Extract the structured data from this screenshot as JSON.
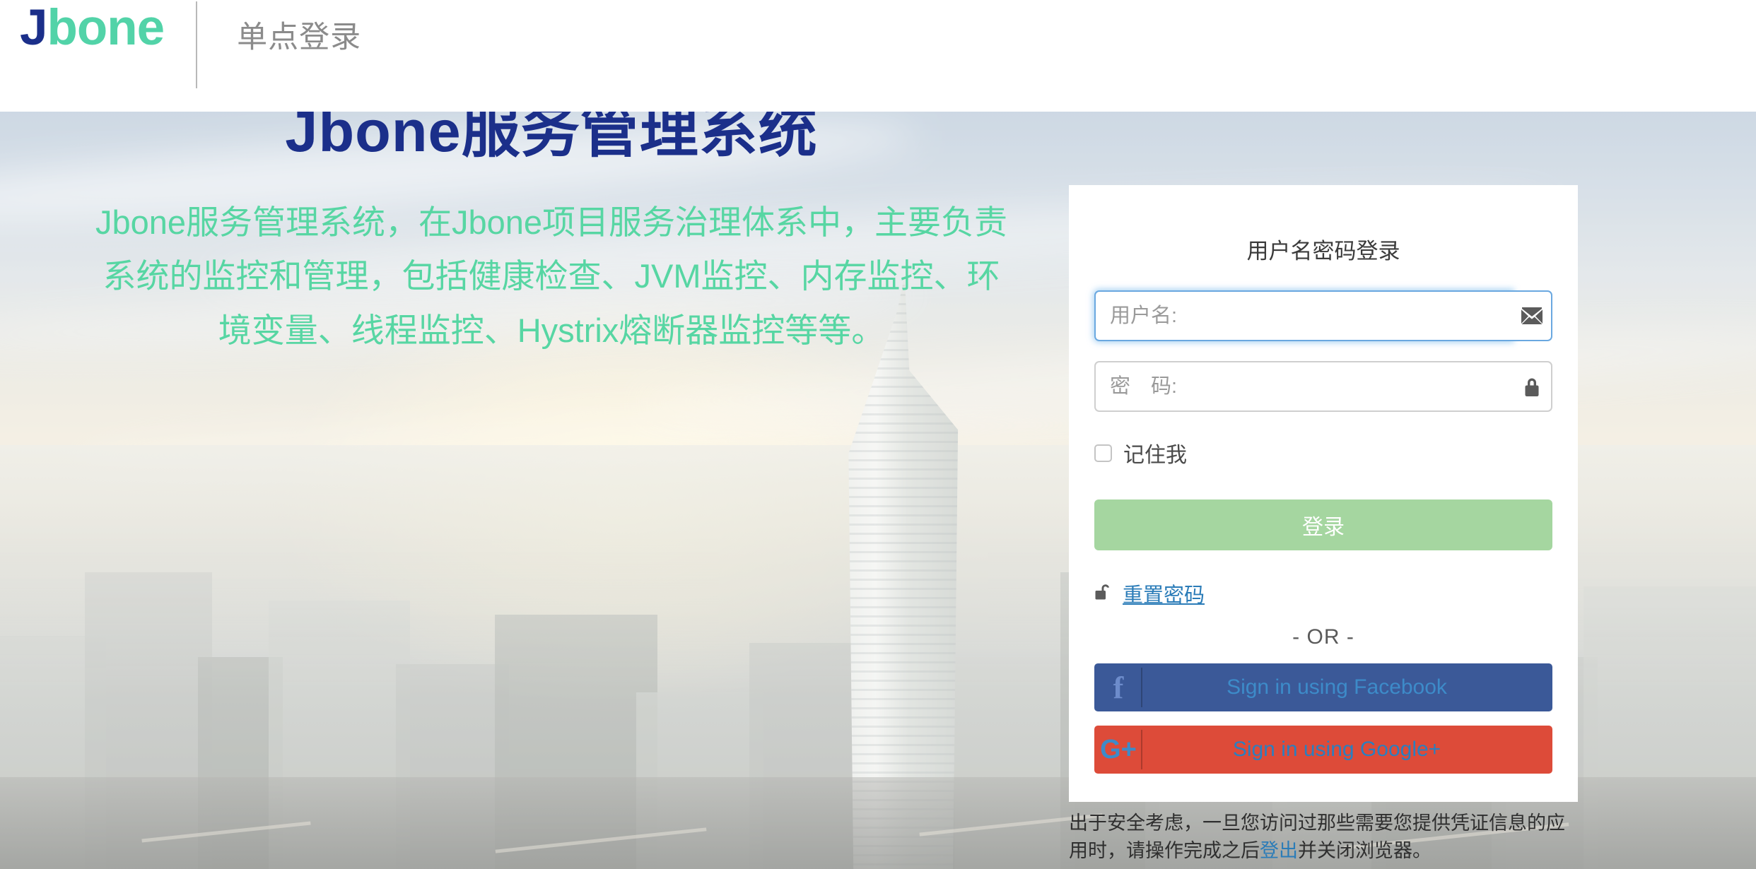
{
  "header": {
    "brand_j": "J",
    "brand_rest": "bone",
    "subtitle": "单点登录"
  },
  "hero": {
    "title": "Jbone服务管理系统",
    "description": "Jbone服务管理系统，在Jbone项目服务治理体系中，主要负责系统的监控和管理，包括健康检查、JVM监控、内存监控、环境变量、线程监控、Hystrix熔断器监控等等。"
  },
  "login": {
    "card_title": "用户名密码登录",
    "username": {
      "value": "",
      "placeholder": "用户名:",
      "icon": "envelope-icon"
    },
    "password": {
      "value": "",
      "placeholder": "密　码:",
      "icon": "lock-icon"
    },
    "remember": {
      "label": "记住我",
      "checked": false
    },
    "submit_label": "登录",
    "reset": {
      "icon": "unlock-icon",
      "label": "重置密码"
    },
    "or_label": "- OR -",
    "social": [
      {
        "provider": "facebook",
        "icon": "facebook-icon",
        "glyph": "f",
        "label": "Sign in using Facebook",
        "bg": "#3b5998"
      },
      {
        "provider": "google-plus",
        "icon": "google-plus-icon",
        "glyph": "G+",
        "label": "Sign in using Google+",
        "bg": "#dd4b39"
      }
    ]
  },
  "security_notice": {
    "part1": "出于安全考虑，一旦您访问过那些需要您提供凭证信息的应用时，请操作完成之后",
    "link": "登出",
    "part2": "并关闭浏览器。"
  },
  "colors": {
    "brand_dark": "#1b2f8a",
    "brand_green": "#52d3a8",
    "hero_desc_green": "#57d6a3",
    "login_button": "#a5d6a0",
    "link_blue": "#2b7cb8",
    "facebook": "#3b5998",
    "google_plus": "#dd4b39",
    "focus_blue": "#6aa8e0"
  }
}
